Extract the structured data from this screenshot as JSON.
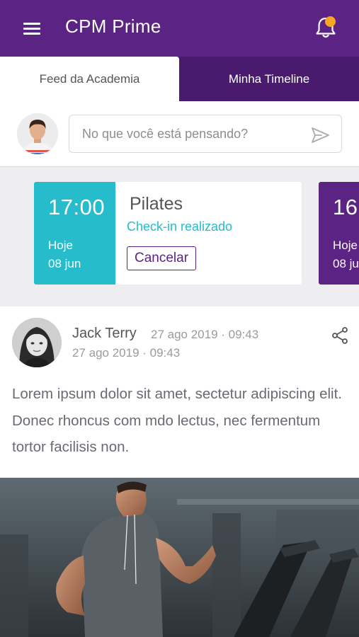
{
  "app": {
    "title": "CPM Prime",
    "accent_color": "#5b2383",
    "notification_color": "#f5a623",
    "menu_icon": "hamburger-menu-icon",
    "notification_icon": "bell-icon"
  },
  "tabs": [
    {
      "label": "Feed da Academia",
      "active": true
    },
    {
      "label": "Minha Timeline",
      "active": false
    }
  ],
  "composer": {
    "placeholder": "No que você está pensando?",
    "send_icon": "send-icon"
  },
  "classes": [
    {
      "time": "17:00",
      "day": "Hoje",
      "date": "08 jun",
      "name": "Pilates",
      "status": "Check-in realizado",
      "action": "Cancelar",
      "color": "#26bccb",
      "status_color": "#26bccb"
    },
    {
      "time": "16:",
      "day": "Hoje",
      "date": "08 jun",
      "color": "#5b2383"
    }
  ],
  "post": {
    "author": "Jack Terry",
    "time": "27 ago 2019 · 09:43",
    "time_repeat": "27 ago 2019 · 09:43",
    "text": "Lorem ipsum dolor sit amet, sectetur adipiscing elit. Donec rhoncus com mdo lectus, nec fermentum tortor facilisis non.",
    "share_icon": "share-icon"
  }
}
